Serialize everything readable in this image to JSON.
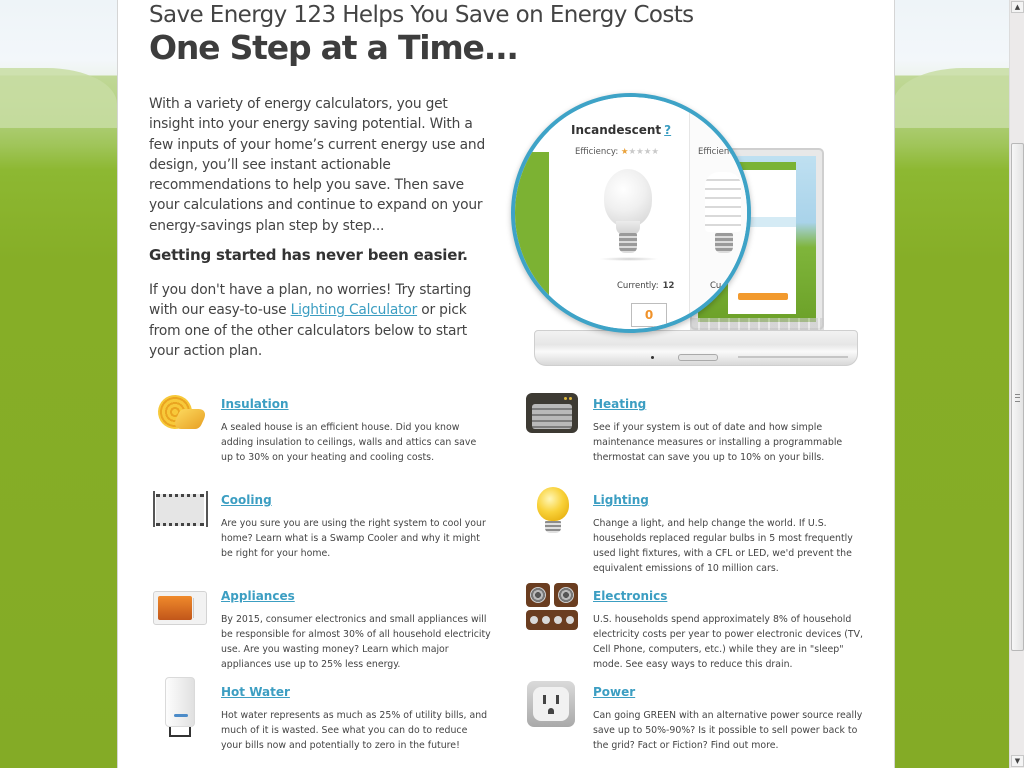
{
  "header": {
    "subtitle": "Save Energy 123 Helps You Save on Energy Costs",
    "title": "One Step at a Time..."
  },
  "intro": {
    "paragraph": "With a variety of energy calculators, you get insight into your energy saving potential. With a few inputs of your home’s current energy use and design, you’ll see instant actionable recommendations to help you save.  Then save your calculations and continue to expand on your energy-savings plan step by step...",
    "getting_started": "Getting started has never been easier.",
    "cta_before": "If you don't have a plan, no worries! Try starting with our easy-to-use ",
    "cta_link": "Lighting Calculator",
    "cta_after": " or pick from one of the other calculators below to start your action plan."
  },
  "hero": {
    "card_title": "Incandescent",
    "help_link": "?",
    "efficiency_label": "Efficiency:",
    "efficiency_rating": 1,
    "efficiency_max": 5,
    "second_card_efficiency_label": "Efficienc",
    "currently_label": "Currently:",
    "currently_value": "12",
    "input_value": "0",
    "second_card_currently_label": "Cu"
  },
  "categories": [
    {
      "icon": "insulation-roll-icon",
      "title": "Insulation",
      "description": "A sealed house is an efficient house. Did you know adding insulation to ceilings, walls and attics can save up to 30% on your heating and cooling costs."
    },
    {
      "icon": "heater-icon",
      "title": "Heating",
      "description": "See if your system is out of date and how simple maintenance measures or installing a programmable thermostat can save you up to 10% on your bills."
    },
    {
      "icon": "swamp-cooler-icon",
      "title": "Cooling",
      "description": "Are you sure you are using the right system to cool your home? Learn what is a Swamp Cooler and why it might be right for your home."
    },
    {
      "icon": "light-bulb-icon",
      "title": "Lighting",
      "description": "Change a light, and help change the world. If U.S. households replaced regular bulbs in 5 most frequently used light fixtures, with a CFL or LED, we'd prevent the equivalent emissions of 10 million cars."
    },
    {
      "icon": "microwave-icon",
      "title": "Appliances",
      "description": "By 2015, consumer electronics and small appliances will be responsible for almost 30% of all household electricity use. Are you wasting money? Learn which major appliances use up to 25% less energy."
    },
    {
      "icon": "speakers-icon",
      "title": "Electronics",
      "description": "U.S. households spend approximately 8% of household electricity costs per year to power electronic devices (TV, Cell Phone, computers, etc.) while they are in \"sleep\" mode. See easy ways to reduce this drain."
    },
    {
      "icon": "water-heater-icon",
      "title": "Hot Water",
      "description": "Hot water represents as much as 25% of utility bills, and much of it is wasted. See what you can do to reduce your bills now and potentially to zero in the future!"
    },
    {
      "icon": "power-outlet-icon",
      "title": "Power",
      "description": "Can going GREEN with an alternative power source really save up to 50%-90%? Is it possible to sell power back to the grid? Fact or Fiction? Find out more."
    }
  ],
  "colors": {
    "link": "#3c9ec2",
    "background_green": "#85ac28",
    "accent_orange": "#f0922a",
    "magnifier_ring": "#3ea3c7"
  },
  "scrollbar": {
    "up_arrow": "▲",
    "down_arrow": "▼"
  }
}
